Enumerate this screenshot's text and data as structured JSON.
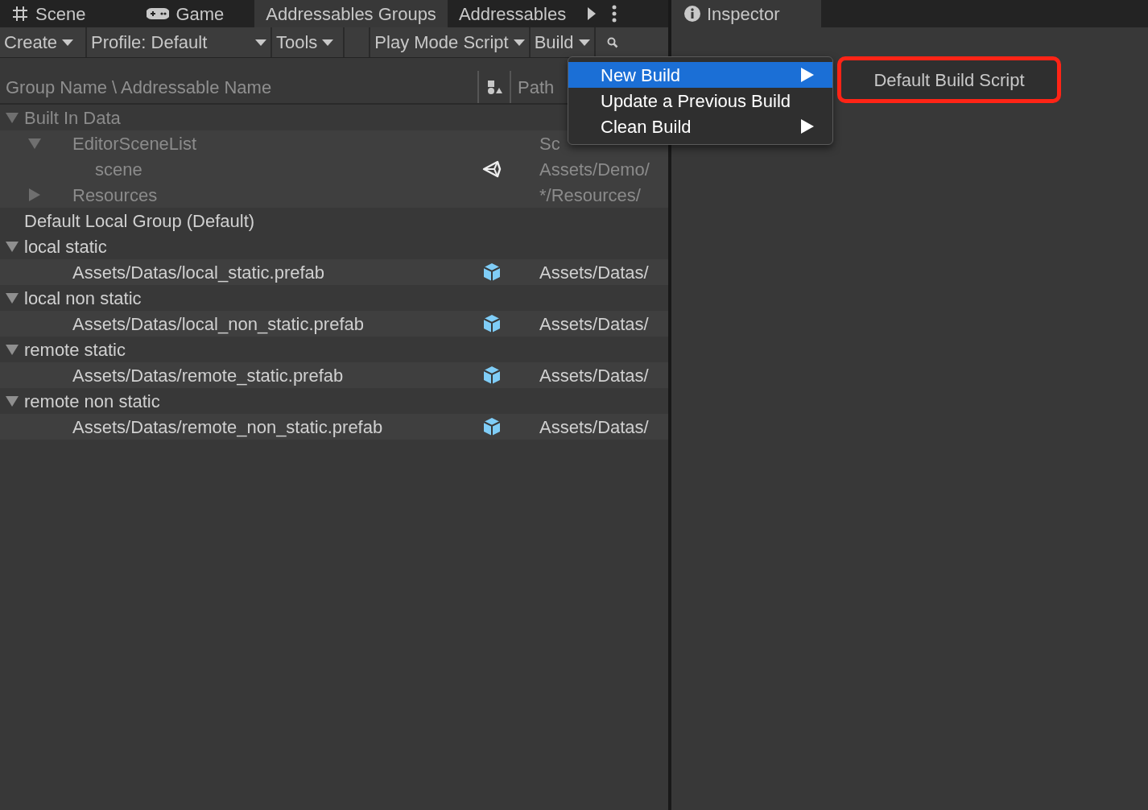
{
  "tabs": [
    {
      "label": "Scene",
      "selected": false
    },
    {
      "label": "Game",
      "selected": false
    },
    {
      "label": "Addressables Groups",
      "selected": true
    },
    {
      "label": "Addressables",
      "selected": false
    }
  ],
  "toolbar": [
    {
      "label": "Create",
      "dropdown": true
    },
    {
      "label": "Profile: Default",
      "dropdown": true
    },
    {
      "label": "Tools",
      "dropdown": true
    },
    {
      "label": "Play Mode Script",
      "dropdown": true
    },
    {
      "label": "Build",
      "dropdown": true
    }
  ],
  "columns": [
    {
      "label": "Group Name \\ Addressable Name"
    },
    {
      "label": "Path"
    }
  ],
  "tree": [
    {
      "name": "Built In Data",
      "disabled": true,
      "expanded": true,
      "children": [
        {
          "name": "EditorSceneList",
          "disabled": true,
          "expanded": true,
          "path": "Sc",
          "children": [
            {
              "name": "scene",
              "disabled": true,
              "kind": "scene",
              "path": "Assets/Demo/"
            }
          ]
        },
        {
          "name": "Resources",
          "disabled": true,
          "expanded": false,
          "path": "*/Resources/"
        }
      ]
    },
    {
      "name": "Default Local Group (Default)",
      "disabled": false
    },
    {
      "name": "local static",
      "disabled": false,
      "expanded": true,
      "children": [
        {
          "name": "Assets/Datas/local_static.prefab",
          "disabled": false,
          "kind": "prefab",
          "path": "Assets/Datas/"
        }
      ]
    },
    {
      "name": "local non static",
      "disabled": false,
      "expanded": true,
      "children": [
        {
          "name": "Assets/Datas/local_non_static.prefab",
          "disabled": false,
          "kind": "prefab",
          "path": "Assets/Datas/"
        }
      ]
    },
    {
      "name": "remote static",
      "disabled": false,
      "expanded": true,
      "children": [
        {
          "name": "Assets/Datas/remote_static.prefab",
          "disabled": false,
          "kind": "prefab",
          "path": "Assets/Datas/"
        }
      ]
    },
    {
      "name": "remote non static",
      "disabled": false,
      "expanded": true,
      "children": [
        {
          "name": "Assets/Datas/remote_non_static.prefab",
          "disabled": false,
          "kind": "prefab",
          "path": "Assets/Datas/"
        }
      ]
    }
  ],
  "build_menu": {
    "items": [
      {
        "label": "New Build",
        "selected": true,
        "submenu": true
      },
      {
        "label": "Update a Previous Build",
        "selected": false,
        "submenu": false
      },
      {
        "label": "Clean Build",
        "selected": false,
        "submenu": true
      }
    ],
    "submenu": {
      "items": [
        {
          "label": "Default Build Script",
          "outlined": true
        }
      ]
    }
  },
  "inspector": {
    "tab": {
      "label": "Inspector",
      "selected": true
    }
  }
}
